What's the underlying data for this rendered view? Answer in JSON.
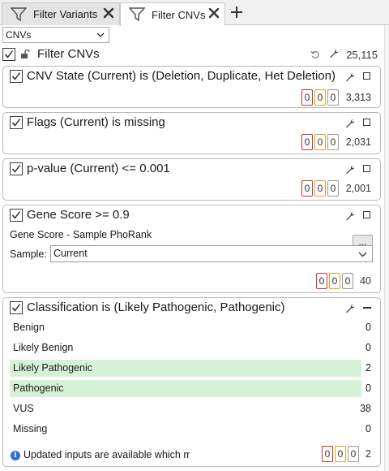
{
  "tabs": [
    {
      "label": "Filter Variants",
      "active": false
    },
    {
      "label": "Filter CNVs",
      "active": true
    }
  ],
  "source_select": {
    "value": "CNVs"
  },
  "root": {
    "label": "Filter CNVs",
    "checked": true,
    "count": "25,115"
  },
  "filters": [
    {
      "title": "CNV State (Current) is (Deletion, Duplicate, Het Deletion)",
      "checked": true,
      "boxes": [
        "0",
        "0",
        "0"
      ],
      "count": "3,313"
    },
    {
      "title": "Flags (Current) is missing",
      "checked": true,
      "boxes": [
        "0",
        "0",
        "0"
      ],
      "count": "2,031"
    },
    {
      "title": "p-value (Current) <= 0.001",
      "checked": true,
      "boxes": [
        "0",
        "0",
        "0"
      ],
      "count": "2,001"
    },
    {
      "title": "Gene Score >= 0.9",
      "checked": true,
      "source_label": "Gene Score - Sample PhoRank",
      "browse_button": "...",
      "sample_label": "Sample:",
      "sample_value": "Current",
      "boxes": [
        "0",
        "0",
        "0"
      ],
      "count": "40"
    },
    {
      "title": "Classification is (Likely Pathogenic, Pathogenic)",
      "checked": true,
      "classes": [
        {
          "name": "Benign",
          "count": "0",
          "selected": false
        },
        {
          "name": "Likely Benign",
          "count": "0",
          "selected": false
        },
        {
          "name": "Likely Pathogenic",
          "count": "2",
          "selected": true
        },
        {
          "name": "Pathogenic",
          "count": "0",
          "selected": true
        },
        {
          "name": "VUS",
          "count": "38",
          "selected": false
        },
        {
          "name": "Missing",
          "count": "0",
          "selected": false
        }
      ],
      "info_text": "Updated inputs are available which may",
      "boxes": [
        "0",
        "0",
        "0"
      ],
      "count": "2"
    }
  ],
  "colors": {
    "selected_row": "#d6f2d6",
    "box_red": "#d03030",
    "box_orange": "#e0a020",
    "info_icon": "#2a6fd6"
  },
  "icons": [
    "funnel-icon",
    "close-icon",
    "plus-icon",
    "chevron-down-icon",
    "lock-icon",
    "undo-icon",
    "wrench-icon",
    "maximize-icon",
    "minimize-icon",
    "info-icon"
  ]
}
